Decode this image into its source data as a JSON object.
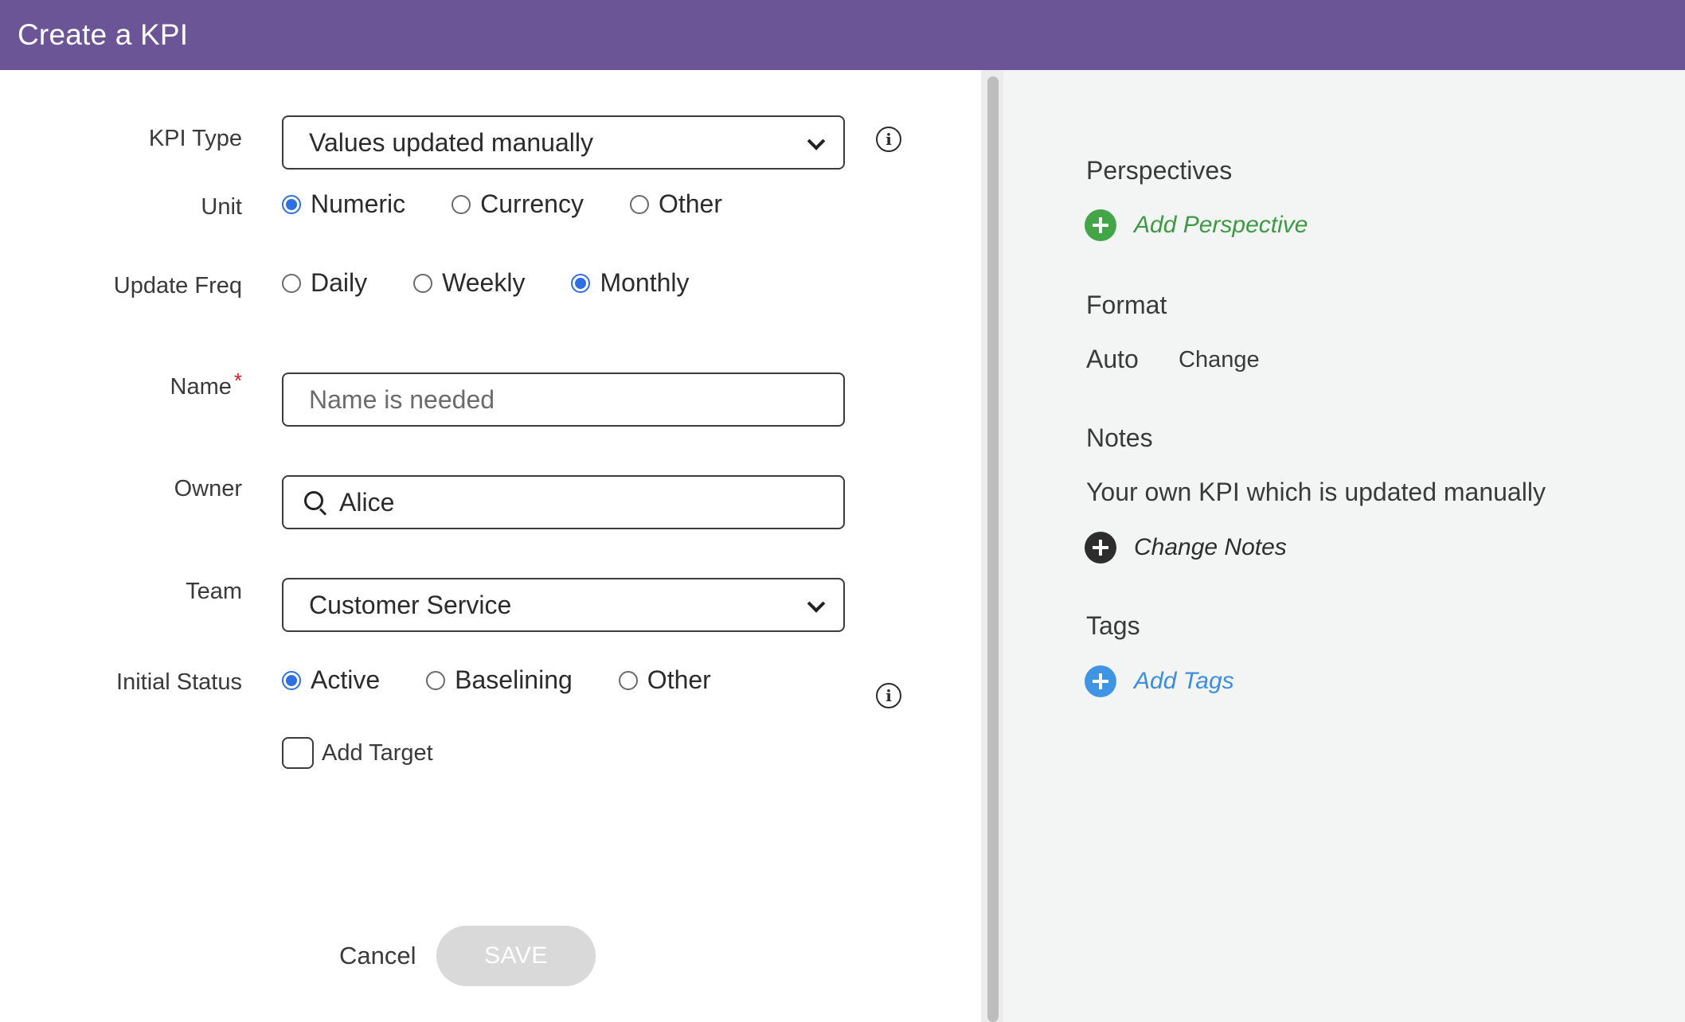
{
  "header": {
    "title": "Create a KPI"
  },
  "form": {
    "kpi_type": {
      "label": "KPI Type",
      "value": "Values updated manually"
    },
    "unit": {
      "label": "Unit",
      "options": [
        "Numeric",
        "Currency",
        "Other"
      ],
      "selected": "Numeric"
    },
    "update_freq": {
      "label": "Update Freq",
      "options": [
        "Daily",
        "Weekly",
        "Monthly"
      ],
      "selected": "Monthly"
    },
    "name": {
      "label": "Name",
      "required_mark": "*",
      "placeholder": "Name is needed",
      "value": ""
    },
    "owner": {
      "label": "Owner",
      "value": "Alice"
    },
    "team": {
      "label": "Team",
      "value": "Customer Service"
    },
    "initial_status": {
      "label": "Initial Status",
      "options": [
        "Active",
        "Baselining",
        "Other"
      ],
      "selected": "Active"
    },
    "add_target": {
      "label": "Add Target",
      "checked": false
    },
    "cancel_label": "Cancel",
    "save_label": "SAVE"
  },
  "side": {
    "perspectives": {
      "title": "Perspectives",
      "action": "Add Perspective"
    },
    "format": {
      "title": "Format",
      "value": "Auto",
      "change_label": "Change"
    },
    "notes": {
      "title": "Notes",
      "text": "Your own KPI which is updated manually",
      "action": "Change Notes"
    },
    "tags": {
      "title": "Tags",
      "action": "Add Tags"
    }
  },
  "icons": {
    "info": "info-icon",
    "search": "search-icon",
    "chevron": "chevron-down-icon",
    "plus": "plus-circle-icon"
  },
  "colors": {
    "header_bg": "#6c5596",
    "radio_selected": "#2f6fe4",
    "perspective_green": "#43a547",
    "tags_blue": "#3f95e4",
    "save_disabled": "#d9d9d9"
  }
}
